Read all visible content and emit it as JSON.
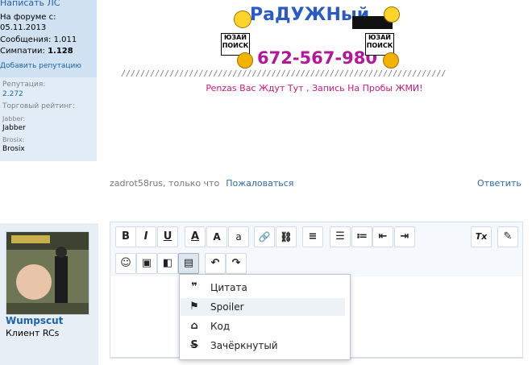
{
  "sidebar_top": {
    "write_pm": "Написать ЛС",
    "joined_label": "На форуме с:",
    "joined_value": "05.11.2013",
    "messages_label": "Сообщения:",
    "messages_value": "1.011",
    "likes_label": "Симпатии:",
    "likes_value": "1.128",
    "add_rep": "Добавить репутацию",
    "rep_label": "Репутация:",
    "rep_value": "2.272",
    "trade_label": "Торговый рейтинг:",
    "jabber_label": "Jabber:",
    "jabber_value": "Jabber",
    "brosix_label": "Brosix:",
    "brosix_value": "Brosix"
  },
  "signature": {
    "title": "РаДУЖНый",
    "sign_text": "ЮЗАЙ ПОИСК",
    "phone": "672-567-980",
    "slashes": "///////////////////////////////////////////////////////////////////",
    "note": "Penzas Вас Ждут Тут , Запись На Пробы ЖМИ!"
  },
  "post_meta": {
    "author": "zadrot58rus",
    "time": ", только что",
    "report": "Пожаловаться",
    "reply": "Ответить"
  },
  "user": {
    "name": "Wumpscut",
    "title": "Клиент RCs"
  },
  "toolbar": {
    "bold": "B",
    "italic": "I",
    "underline": "U",
    "font_color": "A",
    "font_size": "A",
    "font_family": "a",
    "link": "🔗",
    "unlink": "⛓",
    "align": "≡",
    "ul": "☰",
    "ol": "≔",
    "outdent": "⇤",
    "indent": "⇥",
    "remove_format": "Tx",
    "draft": "✎",
    "smilies": "☺",
    "image": "▣",
    "media": "◧",
    "insert": "▤",
    "undo": "↶",
    "redo": "↷"
  },
  "insert_menu": {
    "items": [
      {
        "icon": "❞",
        "label": "Цитата"
      },
      {
        "icon": "⚑",
        "label": "Spoiler"
      },
      {
        "icon": "⌂",
        "label": "Код"
      },
      {
        "icon": "S",
        "label": "Зачёркнутый"
      }
    ]
  },
  "colors": {
    "accent_link": "#1e63a9",
    "signature_pink": "#d2177d",
    "phone_purple": "#b2169a"
  }
}
